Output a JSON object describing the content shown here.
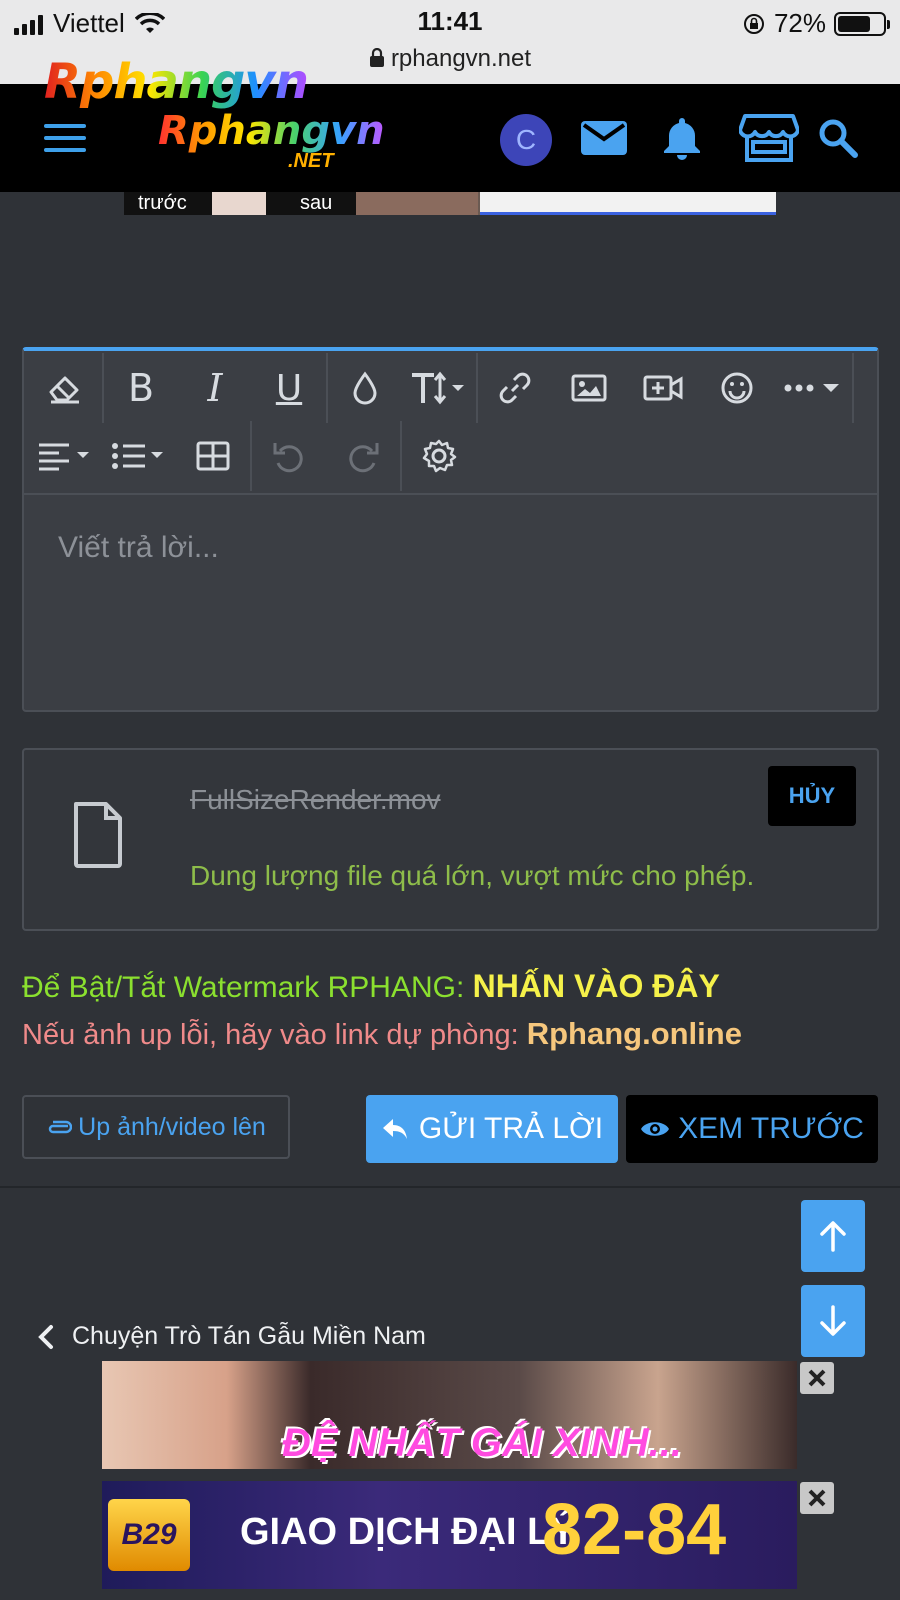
{
  "status_bar": {
    "carrier": "Viettel",
    "time": "11:41",
    "battery": "72%",
    "battery_level": 0.72
  },
  "browser": {
    "url": "rphangvn.net"
  },
  "header": {
    "logo_top": "Rphangvn",
    "logo_main": "Rphangvn",
    "logo_net": ".NET",
    "avatar_letter": "C"
  },
  "ad_top": {
    "label_before": "trước",
    "label_after": "sau"
  },
  "editor": {
    "placeholder": "Viết trả lời..."
  },
  "attachment": {
    "filename": "FullSizeRender.mov",
    "error": "Dung lượng file quá lớn, vượt mức cho phép.",
    "cancel_label": "HỦY"
  },
  "notices": {
    "watermark_text": "Để Bật/Tắt Watermark RPHANG: ",
    "watermark_link": "NHẤN VÀO ĐÂY",
    "fallback_text": "Nếu ảnh up lỗi, hãy vào link dự phòng: ",
    "fallback_link": "Rphang.online"
  },
  "actions": {
    "upload_label": "Up ảnh/video lên",
    "reply_label": "GỬI TRẢ LỜI",
    "preview_label": "XEM TRƯỚC"
  },
  "breadcrumb": {
    "forum": "Chuyện Trò Tán Gẫu Miền Nam"
  },
  "ads": {
    "ad1_text": "ĐỆ NHẤT GÁI XINH...",
    "ad2_logo": "B29",
    "ad2_text": "GIAO DỊCH ĐẠI LÝ",
    "ad2_number": "82-84"
  },
  "colors": {
    "accent": "#4aa3f0",
    "background": "#2f3237",
    "watermark_green": "#8be02f",
    "highlight_yellow": "#f5f14a",
    "fallback_pink": "#f08a8a",
    "error_green": "#8ebd4a"
  }
}
